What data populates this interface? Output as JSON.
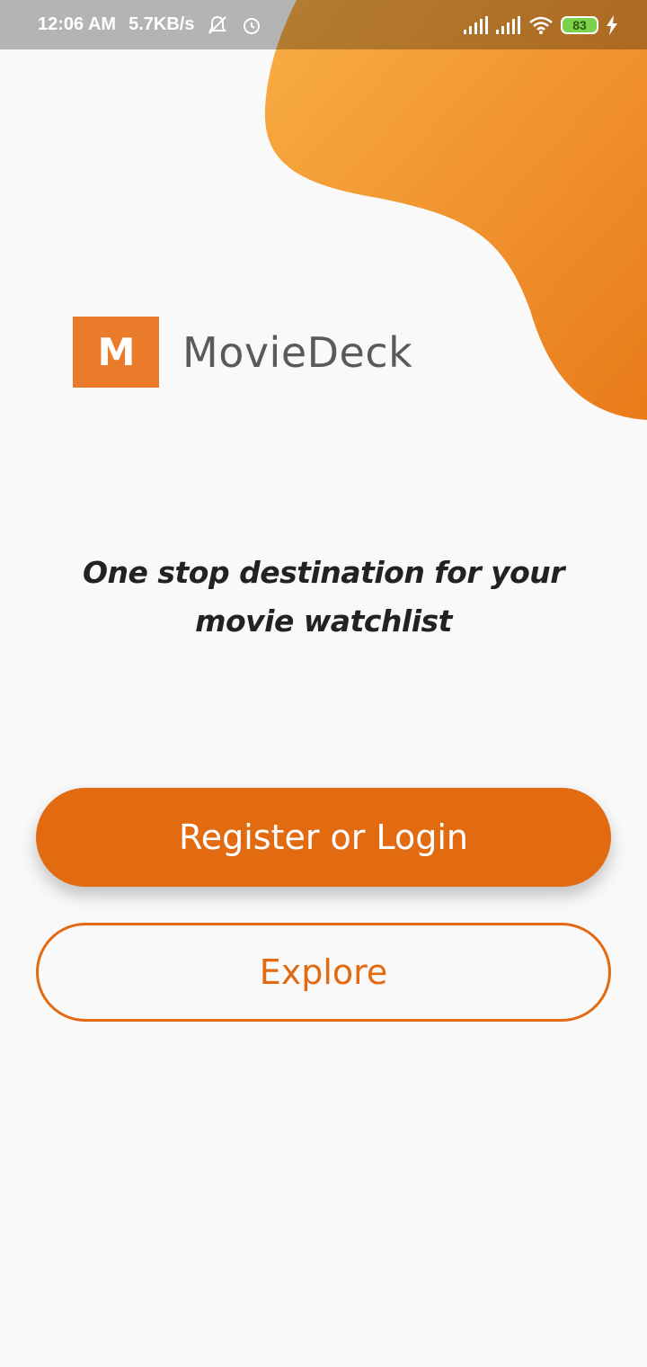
{
  "status_bar": {
    "time": "12:06 AM",
    "network_speed": "5.7KB/s",
    "battery_level": "83",
    "icons": [
      "muted-notifications-icon",
      "alarm-icon",
      "signal-icon",
      "signal-icon",
      "wifi-icon",
      "battery-icon",
      "charging-icon"
    ]
  },
  "brand": {
    "logo_letter": "M",
    "name": "MovieDeck"
  },
  "tagline": {
    "line1": "One stop destination for your",
    "line2": "movie watchlist"
  },
  "actions": {
    "primary_label": "Register or Login",
    "secondary_label": "Explore"
  },
  "colors": {
    "accent": "#e26b12",
    "blob_light": "#f9ae45",
    "blob_dark": "#e97a1a",
    "background": "#f9f9f9"
  }
}
